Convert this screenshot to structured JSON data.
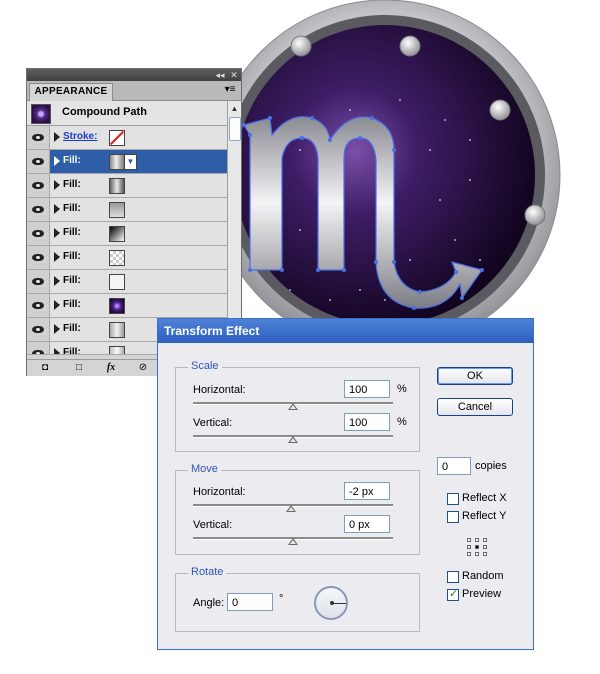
{
  "appearance_panel": {
    "tab_label": "APPEARANCE",
    "header_label": "Compound Path",
    "rows": [
      {
        "label": "Stroke:",
        "swatch": "none-red-slash",
        "selected": false,
        "link": true
      },
      {
        "label": "Fill:",
        "swatch": "metal-gradient",
        "selected": true,
        "link": false
      },
      {
        "label": "Fill:",
        "swatch": "metal-gradient-2",
        "selected": false,
        "link": false
      },
      {
        "label": "Fill:",
        "swatch": "grey-gradient",
        "selected": false,
        "link": false
      },
      {
        "label": "Fill:",
        "swatch": "black-white-gradient",
        "selected": false,
        "link": false
      },
      {
        "label": "Fill:",
        "swatch": "transparent-checker",
        "selected": false,
        "link": false
      },
      {
        "label": "Fill:",
        "swatch": "white",
        "selected": false,
        "link": false
      },
      {
        "label": "Fill:",
        "swatch": "purple-radial",
        "selected": false,
        "link": false
      },
      {
        "label": "Fill:",
        "swatch": "light-gradient",
        "selected": false,
        "link": false
      },
      {
        "label": "Fill:",
        "swatch": "light-gradient-2",
        "selected": false,
        "link": false
      }
    ],
    "bottom_icons": [
      "new-art-icon",
      "clear-icon",
      "fx-icon",
      "delete-icon"
    ],
    "fx_label": "fx"
  },
  "dialog": {
    "title": "Transform Effect",
    "scale": {
      "label": "Scale",
      "horizontal_label": "Horizontal:",
      "horizontal_value": "100",
      "vertical_label": "Vertical:",
      "vertical_value": "100",
      "unit": "%"
    },
    "move": {
      "label": "Move",
      "horizontal_label": "Horizontal:",
      "horizontal_value": "-2 px",
      "vertical_label": "Vertical:",
      "vertical_value": "0 px"
    },
    "rotate": {
      "label": "Rotate",
      "angle_label": "Angle:",
      "angle_value": "0",
      "degree_symbol": "°"
    },
    "ok_label": "OK",
    "cancel_label": "Cancel",
    "copies_value": "0",
    "copies_label": "copies",
    "reflect_x_label": "Reflect X",
    "reflect_y_label": "Reflect Y",
    "random_label": "Random",
    "preview_label": "Preview",
    "reflect_x_checked": false,
    "reflect_y_checked": false,
    "random_checked": false,
    "preview_checked": true
  },
  "colors": {
    "dialog_title": "#2c5fbf",
    "selected_row": "#2f5ea8",
    "group_label": "#2d57b8",
    "artwork_ring": "#c8c8cc",
    "artwork_inner": "#2a0f45",
    "path_highlight": "#4a6fe8"
  }
}
